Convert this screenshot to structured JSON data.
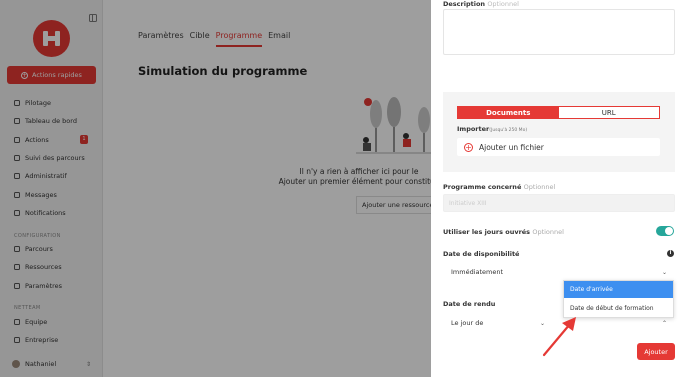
{
  "sidebar": {
    "quick_actions": "Actions rapides",
    "items": [
      {
        "label": "Pilotage"
      },
      {
        "label": "Tableau de bord"
      },
      {
        "label": "Actions",
        "badge": "1"
      },
      {
        "label": "Suivi des parcours"
      },
      {
        "label": "Administratif"
      },
      {
        "label": "Messages"
      },
      {
        "label": "Notifications"
      }
    ],
    "config_label": "CONFIGURATION",
    "config_items": [
      {
        "label": "Parcours"
      },
      {
        "label": "Ressources"
      },
      {
        "label": "Paramètres"
      }
    ],
    "org_label": "NETTEAM",
    "org_items": [
      {
        "label": "Equipe"
      },
      {
        "label": "Entreprise"
      }
    ],
    "user": "Nathaniel"
  },
  "main": {
    "tabs": [
      {
        "label": "Paramètres"
      },
      {
        "label": "Cible"
      },
      {
        "label": "Programme",
        "active": true
      },
      {
        "label": "Email"
      }
    ],
    "title": "Simulation du programme",
    "empty_line1": "Il n'y a rien à afficher ici pour le",
    "empty_line2": "Ajouter un premier élément pour constitue",
    "add_resource": "Ajouter une ressource"
  },
  "drawer": {
    "description_label": "Description",
    "optional": "Optionnel",
    "segment": {
      "documents": "Documents",
      "url": "URL"
    },
    "import_label": "Importer",
    "import_hint": "(Jusqu'à 250 Mo)",
    "add_file": "Ajouter un fichier",
    "programme_label": "Programme concerné",
    "programme_value": "Initiative XIII",
    "working_days_label": "Utiliser les jours ouvrés",
    "working_days_on": true,
    "availability_label": "Date de disponibilité",
    "availability_value": "Immédiatement",
    "due_label": "Date de rendu",
    "due_value": "Le jour de",
    "dropdown_options": [
      "Date d'arrivée",
      "Date de début de formation"
    ],
    "selected_option": "Date d'arrivée",
    "submit": "Ajouter"
  },
  "colors": {
    "brand": "#e53935",
    "toggle": "#26a69a",
    "highlight": "#3d8ff0"
  }
}
